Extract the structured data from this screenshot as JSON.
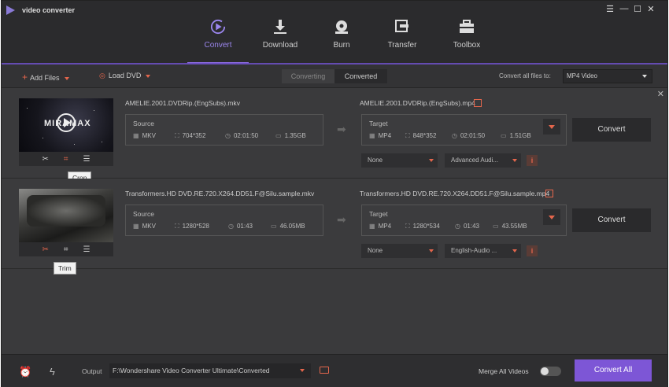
{
  "app": {
    "title": "video converter"
  },
  "window_controls": [
    "☰",
    "—",
    "☐",
    "✕"
  ],
  "nav": [
    {
      "label": "Convert",
      "icon": "convert-icon",
      "active": true
    },
    {
      "label": "Download",
      "icon": "download-icon"
    },
    {
      "label": "Burn",
      "icon": "burn-icon"
    },
    {
      "label": "Transfer",
      "icon": "transfer-icon"
    },
    {
      "label": "Toolbox",
      "icon": "toolbox-icon"
    }
  ],
  "toolbar": {
    "add_files": "Add Files",
    "load_dvd": "Load DVD",
    "tab_converting": "Converting",
    "tab_converted": "Converted",
    "convert_all_files_to": "Convert all files to:",
    "format": "MP4 Video"
  },
  "files": [
    {
      "source_name": "AMELIE.2001.DVDRip.(EngSubs).mkv",
      "target_name": "AMELIE.2001.DVDRip.(EngSubs).mp4",
      "source_label": "Source",
      "target_label": "Target",
      "source": {
        "format": "MKV",
        "resolution": "704*352",
        "duration": "02:01:50",
        "size": "1.35GB"
      },
      "target": {
        "format": "MP4",
        "resolution": "848*352",
        "duration": "02:01:50",
        "size": "1.51GB"
      },
      "subtitle": "None",
      "audio": "Advanced Audi...",
      "convert": "Convert",
      "thumb_text": "MIRAMAX",
      "tooltip": "Crop"
    },
    {
      "source_name": "Transformers.HD DVD.RE.720.X264.DD51.F@Silu.sample.mkv",
      "target_name": "Transformers.HD DVD.RE.720.X264.DD51.F@Silu.sample.mp4",
      "source_label": "Source",
      "target_label": "Target",
      "source": {
        "format": "MKV",
        "resolution": "1280*528",
        "duration": "01:43",
        "size": "46.05MB"
      },
      "target": {
        "format": "MP4",
        "resolution": "1280*534",
        "duration": "01:43",
        "size": "43.55MB"
      },
      "subtitle": "None",
      "audio": "English-Audio ...",
      "convert": "Convert",
      "tooltip": "Trim"
    }
  ],
  "bottom": {
    "output_label": "Output",
    "output_path": "F:\\Wondershare Video Converter Ultimate\\Converted",
    "merge_label": "Merge All Videos",
    "merge_enabled": false,
    "convert_all": "Convert All"
  },
  "colors": {
    "accent": "#7d56d6",
    "highlight": "#e4664c",
    "background": "#3a3a3c"
  }
}
